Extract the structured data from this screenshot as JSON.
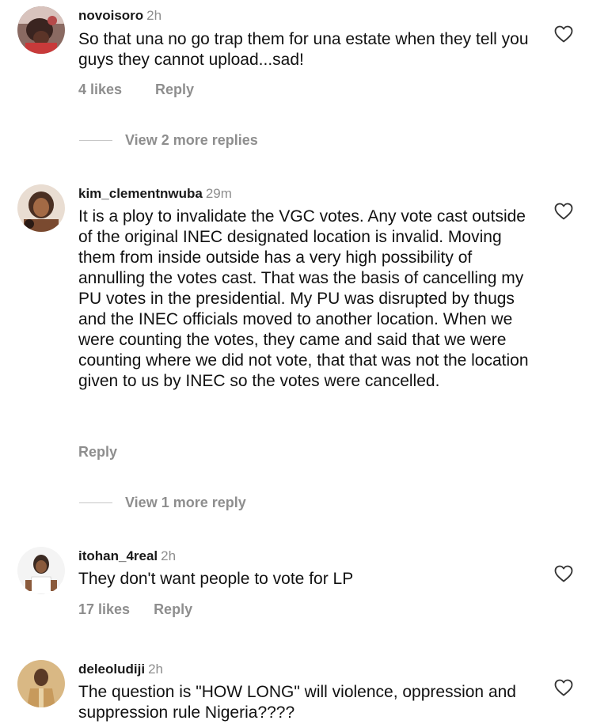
{
  "comments": [
    {
      "username": "novoisoro",
      "time": "2h",
      "text": "So that una no go trap them for una estate when they tell you guys they cannot upload...sad!",
      "likes": "4 likes",
      "reply": "Reply",
      "view_more": "View 2 more replies"
    },
    {
      "username": "kim_clementnwuba",
      "time": "29m",
      "text": "It is a ploy to invalidate the VGC votes. Any vote cast outside of the original INEC designated location is invalid. Moving them from inside outside has a very high possibility of annulling the votes cast. That was the basis of cancelling my PU votes in the presidential. My PU was disrupted by thugs and the INEC officials moved to another location. When we were counting the votes, they came and said that we were counting where we did not vote, that that was not the location given to us by INEC so the votes were cancelled.",
      "reply": "Reply",
      "view_more": "View 1 more reply"
    },
    {
      "username": "itohan_4real",
      "time": "2h",
      "text": "They don't want people to vote for LP",
      "likes": "17 likes",
      "reply": "Reply"
    },
    {
      "username": "deleoludiji",
      "time": "2h",
      "text": "The question is \"HOW LONG\" will violence, oppression and suppression rule Nigeria????"
    }
  ],
  "icons": {
    "like": "heart-outline-icon",
    "avatar": "user-avatar"
  },
  "colors": {
    "text": "#111111",
    "muted": "#8e8e8e",
    "divider": "#c7c7c7"
  }
}
